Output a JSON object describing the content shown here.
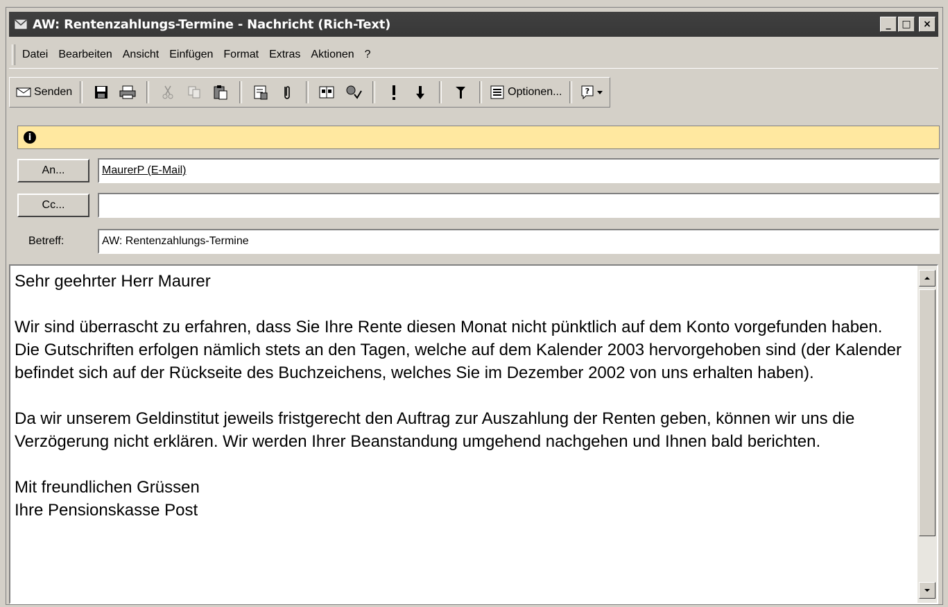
{
  "window": {
    "title": "AW: Rentenzahlungs-Termine - Nachricht (Rich-Text)",
    "controls": {
      "minimize": "_",
      "maximize": "□",
      "close": "×"
    }
  },
  "menu": {
    "items": [
      "Datei",
      "Bearbeiten",
      "Ansicht",
      "Einfügen",
      "Format",
      "Extras",
      "Aktionen",
      "?"
    ]
  },
  "toolbar": {
    "send_label": "Senden",
    "options_label": "Optionen..."
  },
  "infobar": {
    "icon": "info-icon"
  },
  "address": {
    "to_button": "An...",
    "to_value": "MaurerP (E-Mail)",
    "cc_button": "Cc...",
    "cc_value": "",
    "subject_label": "Betreff:",
    "subject_value": "AW: Rentenzahlungs-Termine"
  },
  "message": {
    "greeting": "Sehr geehrter Herr Maurer",
    "paragraph1": "Wir sind überrascht zu erfahren, dass Sie Ihre Rente diesen Monat nicht pünktlich auf dem Konto vorgefunden haben. Die Gutschriften erfolgen nämlich stets an den Tagen, welche auf dem Kalender 2003 hervorgehoben sind (der Kalender befindet sich auf der Rückseite des Buchzeichens, welches Sie im Dezember 2002 von uns erhalten haben).",
    "paragraph2": "Da wir unserem Geldinstitut jeweils fristgerecht den Auftrag zur Auszahlung der Renten geben, können wir uns die Verzögerung nicht erklären. Wir werden Ihrer Beanstandung umgehend nachgehen und Ihnen bald berichten.",
    "closing": "Mit freundlichen Grüssen",
    "signature": "Ihre Pensionskasse Post"
  }
}
